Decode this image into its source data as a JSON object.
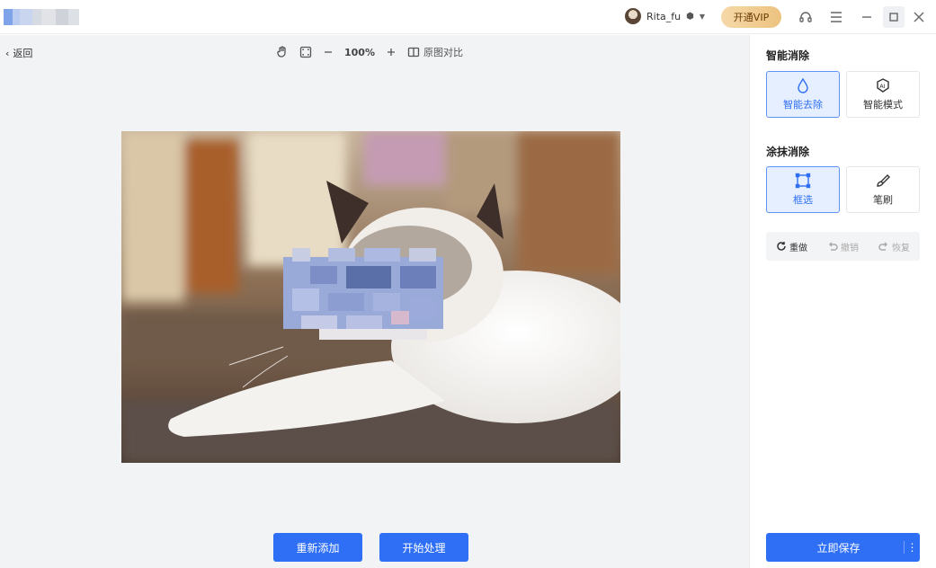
{
  "header": {
    "username": "Rita_fu",
    "vip_label": "开通VIP"
  },
  "workspace": {
    "back_label": "返回",
    "zoom_level": "100%",
    "compare_label": "原图对比",
    "re_add_label": "重新添加",
    "start_label": "开始处理"
  },
  "panel": {
    "smart_title": "智能消除",
    "smart_options": [
      {
        "label": "智能去除",
        "icon": "drop-icon",
        "active": true
      },
      {
        "label": "智能模式",
        "icon": "ai-icon",
        "active": false
      }
    ],
    "paint_title": "涂抹消除",
    "paint_options": [
      {
        "label": "框选",
        "icon": "box-select-icon",
        "active": true
      },
      {
        "label": "笔刷",
        "icon": "brush-icon",
        "active": false
      }
    ],
    "history": {
      "redo_label": "重做",
      "undo_label": "撤销",
      "restore_label": "恢复"
    },
    "save_label": "立即保存"
  },
  "colors": {
    "primary": "#2e6ff5",
    "active_bg": "#e6efff",
    "vip_gold": "#ecc27f"
  }
}
